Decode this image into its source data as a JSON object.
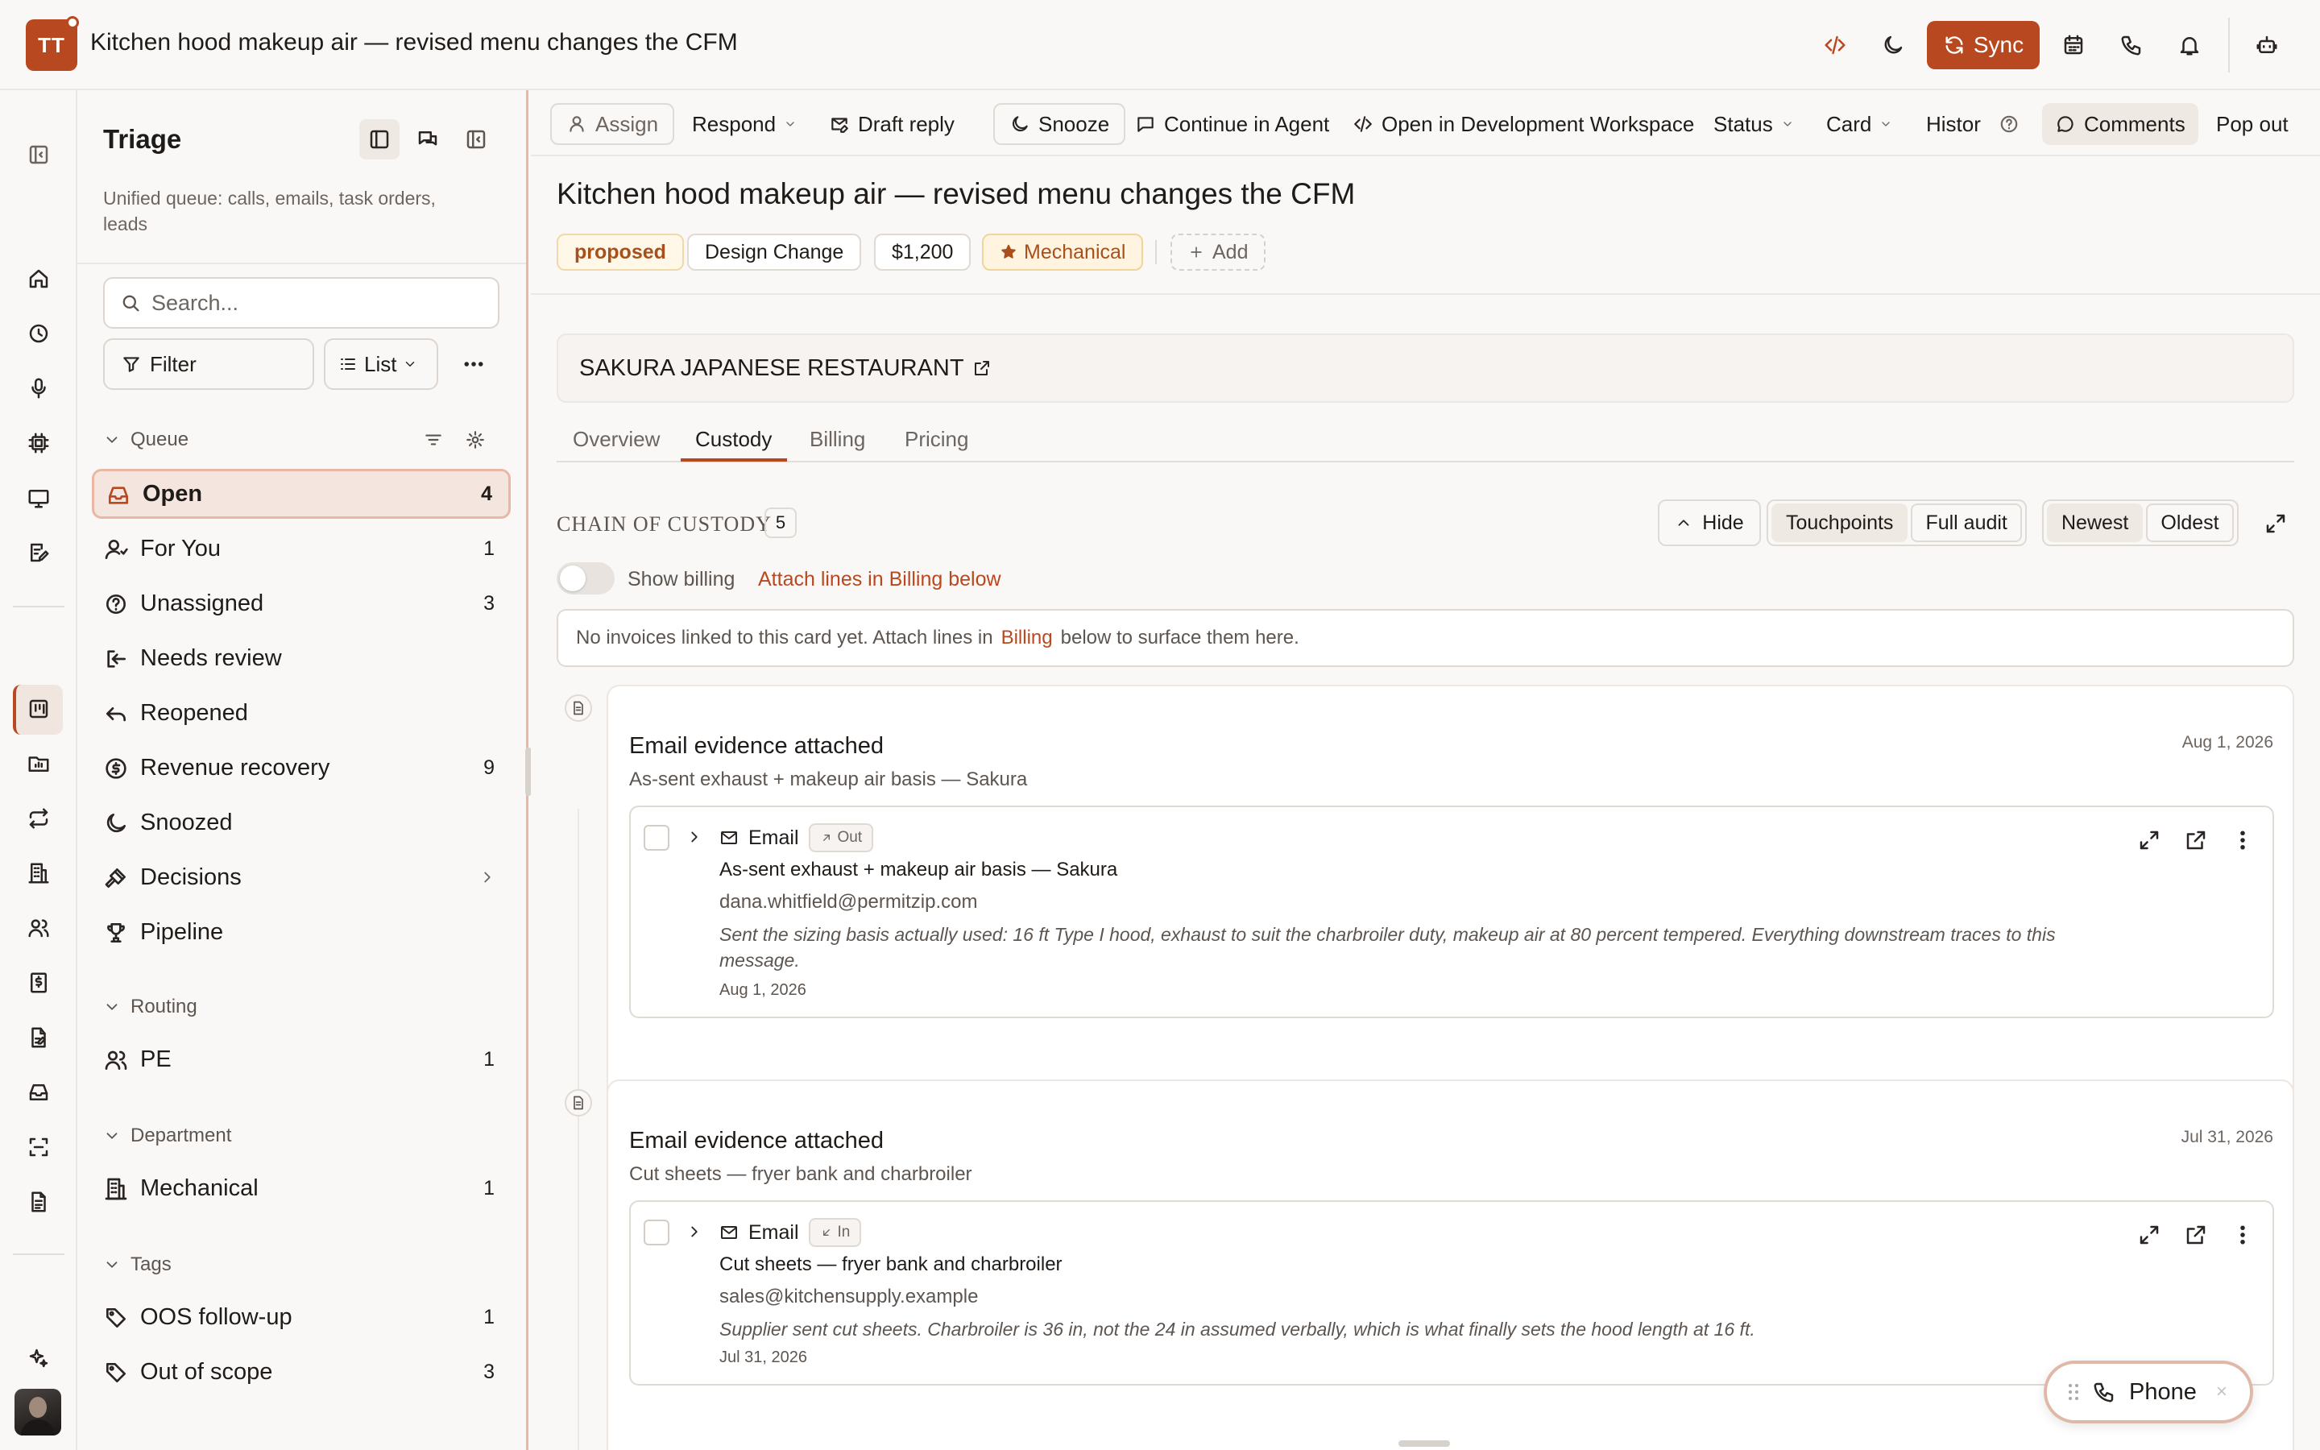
{
  "app": {
    "avatar_initials": "TT",
    "window_title": "Kitchen hood makeup air — revised menu changes the CFM",
    "sync_label": "Sync",
    "accent_color": "#b8481f"
  },
  "sidebar": {
    "title": "Triage",
    "subtitle": "Unified queue: calls, emails, task orders, leads",
    "search_placeholder": "Search...",
    "filter_label": "Filter",
    "view_label": "List",
    "groups": {
      "queue": "Queue",
      "routing": "Routing",
      "department": "Department",
      "tags": "Tags"
    },
    "queue_items": [
      {
        "label": "Open",
        "count": "4",
        "icon": "inbox-icon"
      },
      {
        "label": "For You",
        "count": "1",
        "icon": "user-icon"
      },
      {
        "label": "Unassigned",
        "count": "3",
        "icon": "question-icon"
      },
      {
        "label": "Needs review",
        "count": "",
        "icon": "login-icon"
      },
      {
        "label": "Reopened",
        "count": "",
        "icon": "undo-icon"
      },
      {
        "label": "Revenue recovery",
        "count": "9",
        "icon": "dollar-icon"
      },
      {
        "label": "Snoozed",
        "count": "",
        "icon": "moon-icon"
      },
      {
        "label": "Decisions",
        "count": "",
        "icon": "gavel-icon"
      },
      {
        "label": "Pipeline",
        "count": "",
        "icon": "trophy-icon"
      }
    ],
    "routing_items": [
      {
        "label": "PE",
        "count": "1",
        "icon": "users-icon"
      }
    ],
    "department_items": [
      {
        "label": "Mechanical",
        "count": "1",
        "icon": "building-icon"
      }
    ],
    "tag_items": [
      {
        "label": "OOS follow-up",
        "count": "1",
        "icon": "tag-icon"
      },
      {
        "label": "Out of scope",
        "count": "3",
        "icon": "tag-icon"
      }
    ]
  },
  "toolbar": {
    "assign": "Assign",
    "respond": "Respond",
    "draft_reply": "Draft reply",
    "snooze": "Snooze",
    "continue_agent": "Continue in Agent",
    "open_dev": "Open in Development Workspace",
    "status": "Status",
    "card": "Card",
    "history": "Histor",
    "comments": "Comments",
    "pop_out": "Pop out"
  },
  "card": {
    "title": "Kitchen hood makeup air — revised menu changes the CFM",
    "tags": {
      "status": "proposed",
      "type": "Design Change",
      "amount": "$1,200",
      "department": "Mechanical",
      "add": "Add"
    },
    "client": "SAKURA JAPANESE RESTAURANT",
    "tabs": [
      "Overview",
      "Custody",
      "Billing",
      "Pricing"
    ],
    "active_tab": "Custody"
  },
  "custody": {
    "label": "CHAIN OF CUSTODY",
    "count": "5",
    "hide": "Hide",
    "view_options": [
      "Touchpoints",
      "Full audit"
    ],
    "sort_options": [
      "Newest",
      "Oldest"
    ],
    "show_billing": "Show billing",
    "attach_link": "Attach lines in Billing below",
    "no_invoice_pre": "No invoices linked to this card yet. Attach lines in",
    "no_invoice_link": "Billing",
    "no_invoice_post": "below to surface them here."
  },
  "events": [
    {
      "title": "Email evidence attached",
      "subtitle": "As-sent exhaust + makeup air basis — Sakura",
      "date": "Aug 1, 2026",
      "message": {
        "type": "Email",
        "direction": "Out",
        "subject": "As-sent exhaust + makeup air basis — Sakura",
        "from": "dana.whitfield@permitzip.com",
        "body": "Sent the sizing basis actually used: 16 ft Type I hood, exhaust to suit the charbroiler duty, makeup air at 80 percent tempered. Everything downstream traces to this message.",
        "date": "Aug 1, 2026"
      }
    },
    {
      "title": "Email evidence attached",
      "subtitle": "Cut sheets — fryer bank and charbroiler",
      "date": "Jul 31, 2026",
      "message": {
        "type": "Email",
        "direction": "In",
        "subject": "Cut sheets — fryer bank and charbroiler",
        "from": "sales@kitchensupply.example",
        "body": "Supplier sent cut sheets. Charbroiler is 36 in, not the 24 in assumed verbally, which is what finally sets the hood length at 16 ft.",
        "date": "Jul 31, 2026"
      }
    }
  ],
  "phone": {
    "label": "Phone",
    "close": "×"
  }
}
